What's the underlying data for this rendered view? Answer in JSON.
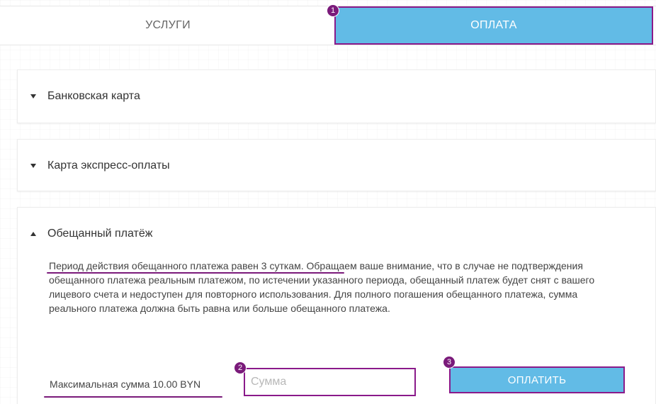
{
  "tabs": {
    "services_label": "УСЛУГИ",
    "payment_label": "ОПЛАТА"
  },
  "markers": [
    "1",
    "2",
    "3"
  ],
  "accordion": {
    "bank_card": "Банковская карта",
    "express_card": "Карта экспресс-оплаты",
    "promised_payment": {
      "title": "Обещанный платёж",
      "description": "Период действия обещанного платежа равен 3 суткам. Обращаем ваше внимание, что в случае не подтверждения обещанного платежа реальным платежом, по истечении указанного периода, обещанный платеж будет снят с вашего лицевого счета и недоступен для повторного использования. Для полного погашения обещанного платежа, сумма реального платежа должна быть равна или больше обещанного платежа.",
      "max_sum": "Максимальная сумма 10.00 BYN",
      "amount_placeholder": "Сумма",
      "pay_label": "ОПЛАТИТЬ"
    }
  },
  "colors": {
    "accent": "#62bbe6",
    "highlight": "#8a1a8a"
  },
  "icons": [
    "caret-down-icon",
    "caret-up-icon"
  ]
}
